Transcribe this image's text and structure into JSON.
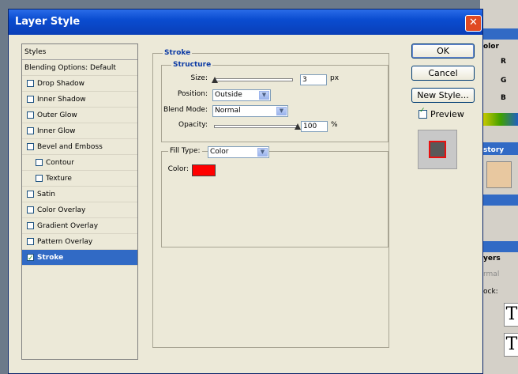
{
  "dialog": {
    "title": "Layer Style",
    "close_glyph": "✕"
  },
  "styles_list": {
    "header": "Styles",
    "items": [
      {
        "label": "Blending Options: Default",
        "checkbox": false,
        "checked": false,
        "indent": false,
        "selected": false
      },
      {
        "label": "Drop Shadow",
        "checkbox": true,
        "checked": false,
        "indent": false,
        "selected": false
      },
      {
        "label": "Inner Shadow",
        "checkbox": true,
        "checked": false,
        "indent": false,
        "selected": false
      },
      {
        "label": "Outer Glow",
        "checkbox": true,
        "checked": false,
        "indent": false,
        "selected": false
      },
      {
        "label": "Inner Glow",
        "checkbox": true,
        "checked": false,
        "indent": false,
        "selected": false
      },
      {
        "label": "Bevel and Emboss",
        "checkbox": true,
        "checked": false,
        "indent": false,
        "selected": false
      },
      {
        "label": "Contour",
        "checkbox": true,
        "checked": false,
        "indent": true,
        "selected": false
      },
      {
        "label": "Texture",
        "checkbox": true,
        "checked": false,
        "indent": true,
        "selected": false
      },
      {
        "label": "Satin",
        "checkbox": true,
        "checked": false,
        "indent": false,
        "selected": false
      },
      {
        "label": "Color Overlay",
        "checkbox": true,
        "checked": false,
        "indent": false,
        "selected": false
      },
      {
        "label": "Gradient Overlay",
        "checkbox": true,
        "checked": false,
        "indent": false,
        "selected": false
      },
      {
        "label": "Pattern Overlay",
        "checkbox": true,
        "checked": false,
        "indent": false,
        "selected": false
      },
      {
        "label": "Stroke",
        "checkbox": true,
        "checked": true,
        "indent": false,
        "selected": true
      }
    ]
  },
  "stroke": {
    "group_label": "Stroke",
    "structure_label": "Structure",
    "size_label": "Size:",
    "size_value": "3",
    "size_unit": "px",
    "size_fraction": 0.01,
    "position_label": "Position:",
    "position_value": "Outside",
    "blend_label": "Blend Mode:",
    "blend_value": "Normal",
    "opacity_label": "Opacity:",
    "opacity_value": "100",
    "opacity_unit": "%",
    "opacity_fraction": 1.0,
    "fill_type_label": "Fill Type:",
    "fill_type_value": "Color",
    "color_label": "Color:",
    "color_hex": "#ff0000"
  },
  "buttons": {
    "ok": "OK",
    "cancel": "Cancel",
    "new_style": "New Style...",
    "preview_label": "Preview",
    "preview_checked": true
  },
  "background": {
    "color_panel_label": "olor",
    "r": "R",
    "g": "G",
    "b": "B",
    "history_label": "story",
    "layers_label": "yers",
    "blend_label": "rmal",
    "lock_label": "ock:",
    "type_glyph": "T"
  },
  "colors": {
    "title_blue": "#0a4cd0",
    "selection": "#316ac5",
    "dialog_bg": "#ece9d8",
    "stroke_color": "#ff0000",
    "preview_fill": "#595959"
  }
}
